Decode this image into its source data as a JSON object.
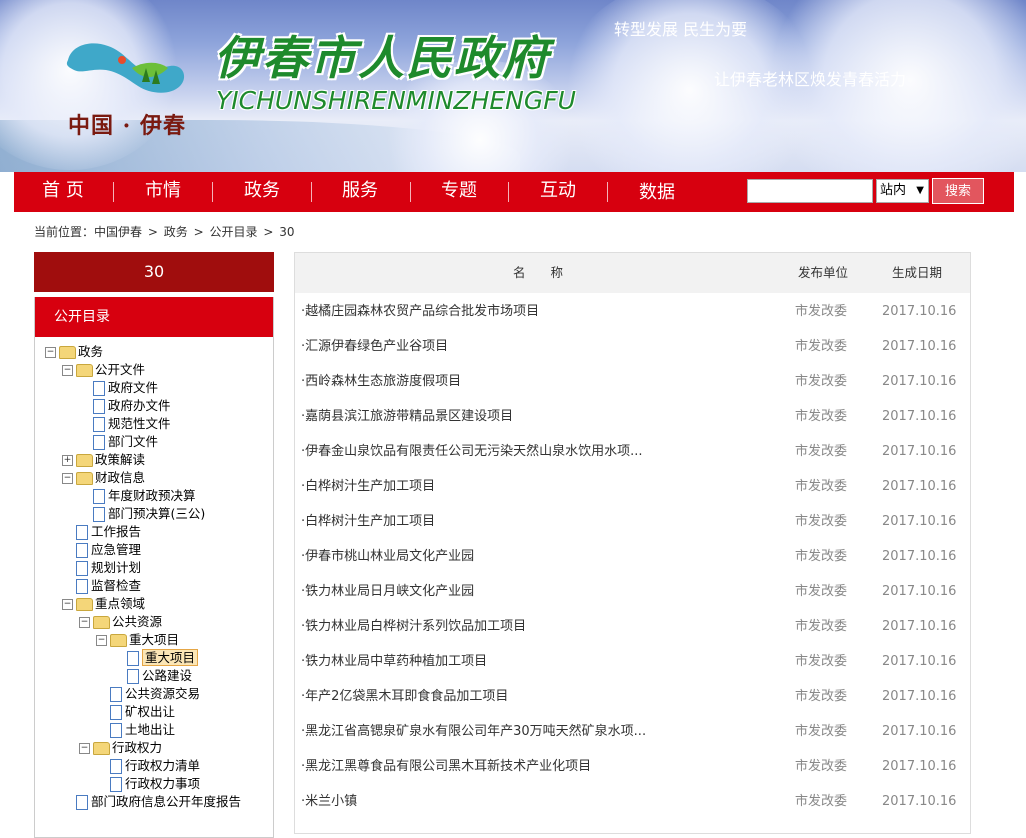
{
  "header": {
    "logo_text": "中国 · 伊春",
    "site_title": "伊春市人民政府",
    "site_title_en": "YICHUNSHIRENMINZHENGFU",
    "slogan1": "转型发展 民生为要",
    "slogan2": "让伊春老林区焕发青春活力"
  },
  "nav": {
    "items": [
      "首 页",
      "市情",
      "政务",
      "服务",
      "专题",
      "互动",
      "数据"
    ],
    "search_select": "站内",
    "search_button": "搜索"
  },
  "breadcrumb": [
    "当前位置：中国伊春",
    ">",
    "政务",
    ">",
    "公开目录",
    ">",
    "30"
  ],
  "sidebar": {
    "title": "30",
    "head": "公开目录",
    "tree": [
      {
        "label": "政务",
        "level": 0,
        "type": "folder",
        "toggle": "−"
      },
      {
        "label": "公开文件",
        "level": 1,
        "type": "folder",
        "toggle": "−"
      },
      {
        "label": "政府文件",
        "level": 2,
        "type": "doc"
      },
      {
        "label": "政府办文件",
        "level": 2,
        "type": "doc"
      },
      {
        "label": "规范性文件",
        "level": 2,
        "type": "doc"
      },
      {
        "label": "部门文件",
        "level": 2,
        "type": "doc"
      },
      {
        "label": "政策解读",
        "level": 1,
        "type": "folder",
        "toggle": "+"
      },
      {
        "label": "财政信息",
        "level": 1,
        "type": "folder",
        "toggle": "−"
      },
      {
        "label": "年度财政预决算",
        "level": 2,
        "type": "doc"
      },
      {
        "label": "部门预决算(三公)",
        "level": 2,
        "type": "doc"
      },
      {
        "label": "工作报告",
        "level": 1,
        "type": "doc"
      },
      {
        "label": "应急管理",
        "level": 1,
        "type": "doc"
      },
      {
        "label": "规划计划",
        "level": 1,
        "type": "doc"
      },
      {
        "label": "监督检查",
        "level": 1,
        "type": "doc"
      },
      {
        "label": "重点领域",
        "level": 1,
        "type": "folder",
        "toggle": "−"
      },
      {
        "label": "公共资源",
        "level": 2,
        "type": "folder",
        "toggle": "−"
      },
      {
        "label": "重大项目",
        "level": 3,
        "type": "folder",
        "toggle": "−"
      },
      {
        "label": "重大项目",
        "level": 4,
        "type": "doc",
        "selected": true
      },
      {
        "label": "公路建设",
        "level": 4,
        "type": "doc"
      },
      {
        "label": "公共资源交易",
        "level": 3,
        "type": "doc"
      },
      {
        "label": "矿权出让",
        "level": 3,
        "type": "doc"
      },
      {
        "label": "土地出让",
        "level": 3,
        "type": "doc"
      },
      {
        "label": "行政权力",
        "level": 2,
        "type": "folder",
        "toggle": "−"
      },
      {
        "label": "行政权力清单",
        "level": 3,
        "type": "doc"
      },
      {
        "label": "行政权力事项",
        "level": 3,
        "type": "doc"
      },
      {
        "label": "部门政府信息公开年度报告",
        "level": 1,
        "type": "doc"
      }
    ]
  },
  "list": {
    "headers": {
      "name": "名　　称",
      "unit": "发布单位",
      "date": "生成日期"
    },
    "rows": [
      {
        "title": "·越橘庄园森林农贸产品综合批发市场项目",
        "unit": "市发改委",
        "date": "2017.10.16"
      },
      {
        "title": "·汇源伊春绿色产业谷项目",
        "unit": "市发改委",
        "date": "2017.10.16"
      },
      {
        "title": "·西岭森林生态旅游度假项目",
        "unit": "市发改委",
        "date": "2017.10.16"
      },
      {
        "title": "·嘉荫县滨江旅游带精品景区建设项目",
        "unit": "市发改委",
        "date": "2017.10.16"
      },
      {
        "title": "·伊春金山泉饮品有限责任公司无污染天然山泉水饮用水项...",
        "unit": "市发改委",
        "date": "2017.10.16"
      },
      {
        "title": "·白桦树汁生产加工项目",
        "unit": "市发改委",
        "date": "2017.10.16"
      },
      {
        "title": "·白桦树汁生产加工项目",
        "unit": "市发改委",
        "date": "2017.10.16"
      },
      {
        "title": "·伊春市桃山林业局文化产业园",
        "unit": "市发改委",
        "date": "2017.10.16"
      },
      {
        "title": "·铁力林业局日月峡文化产业园",
        "unit": "市发改委",
        "date": "2017.10.16"
      },
      {
        "title": "·铁力林业局白桦树汁系列饮品加工项目",
        "unit": "市发改委",
        "date": "2017.10.16"
      },
      {
        "title": "·铁力林业局中草药种植加工项目",
        "unit": "市发改委",
        "date": "2017.10.16"
      },
      {
        "title": "·年产2亿袋黑木耳即食食品加工项目",
        "unit": "市发改委",
        "date": "2017.10.16"
      },
      {
        "title": "·黑龙江省高锶泉矿泉水有限公司年产30万吨天然矿泉水项...",
        "unit": "市发改委",
        "date": "2017.10.16"
      },
      {
        "title": "·黑龙江黑尊食品有限公司黑木耳新技术产业化项目",
        "unit": "市发改委",
        "date": "2017.10.16"
      },
      {
        "title": "·米兰小镇",
        "unit": "市发改委",
        "date": "2017.10.16"
      }
    ]
  },
  "colors": {
    "nav_red": "#d7000f",
    "title_green": "#1e8a2c",
    "dark_red": "#a00d0d"
  }
}
